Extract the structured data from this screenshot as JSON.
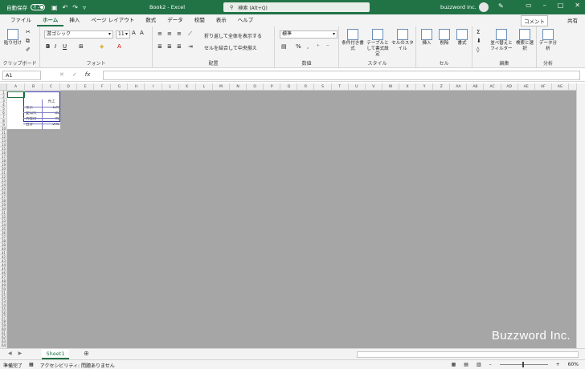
{
  "titlebar": {
    "autosave_label": "自動保存",
    "autosave_state": "オフ",
    "doc_title": "Book2 - Excel",
    "search_placeholder": "検索 (Alt+Q)",
    "user_name": "buzzword Inc."
  },
  "tabs": [
    "ファイル",
    "ホーム",
    "挿入",
    "ページ レイアウト",
    "数式",
    "データ",
    "校閲",
    "表示",
    "ヘルプ"
  ],
  "active_tab": "ホーム",
  "comment_label": "コメント",
  "share_label": "共有",
  "ribbon": {
    "clipboard": {
      "paste": "貼り付け",
      "label": "クリップボード"
    },
    "font": {
      "name": "游ゴシック",
      "size": "11",
      "label": "フォント"
    },
    "alignment": {
      "wrap": "折り返して全体を表示する",
      "merge": "セルを結合して中央揃え",
      "label": "配置"
    },
    "number": {
      "format": "標準",
      "label": "数値"
    },
    "styles": {
      "conditional": "条件付き書式",
      "table": "テーブルとして書式設定",
      "cell": "セルのスタイル",
      "label": "スタイル"
    },
    "cells": {
      "insert": "挿入",
      "delete": "削除",
      "format": "書式",
      "label": "セル"
    },
    "editing": {
      "sort": "並べ替えとフィルター",
      "find": "検索と選択",
      "label": "編集"
    },
    "analysis": {
      "analyze": "データ分析",
      "label": "分析"
    }
  },
  "namebox": "A1",
  "columns": [
    "A",
    "B",
    "C",
    "D",
    "E",
    "F",
    "G",
    "H",
    "I",
    "J",
    "K",
    "L",
    "M",
    "N",
    "O",
    "P",
    "Q",
    "R",
    "S",
    "T",
    "U",
    "V",
    "W",
    "X",
    "Y",
    "Z",
    "AA",
    "AB",
    "AC",
    "AD",
    "AE",
    "AF",
    "AG"
  ],
  "rows": [
    "1",
    "2",
    "3",
    "4",
    "5",
    "6",
    "7",
    "8",
    "9",
    "10",
    "11",
    "12",
    "13",
    "14",
    "15",
    "16",
    "17",
    "18",
    "19",
    "20",
    "21",
    "22",
    "23",
    "24",
    "25",
    "26",
    "27",
    "28",
    "29",
    "30",
    "31",
    "32",
    "33",
    "34",
    "35",
    "36",
    "37",
    "38",
    "39",
    "40",
    "41",
    "42",
    "43",
    "44",
    "45",
    "46",
    "47",
    "48",
    "49",
    "50",
    "51",
    "52",
    "53",
    "54",
    "55",
    "56",
    "57",
    "58",
    "59",
    "60",
    "61",
    "62",
    "63",
    "64"
  ],
  "table": {
    "header": "売上",
    "rows": [
      {
        "name": "東京",
        "value": "120"
      },
      {
        "name": "愛知県",
        "value": "80"
      },
      {
        "name": "大阪府",
        "value": "95"
      },
      {
        "name": "合計",
        "value": "295"
      }
    ]
  },
  "sheet_tab": "Sheet1",
  "status": {
    "ready": "準備完了",
    "accessibility": "アクセシビリティ: 問題ありません",
    "zoom": "60%"
  },
  "watermark": "Buzzword Inc."
}
